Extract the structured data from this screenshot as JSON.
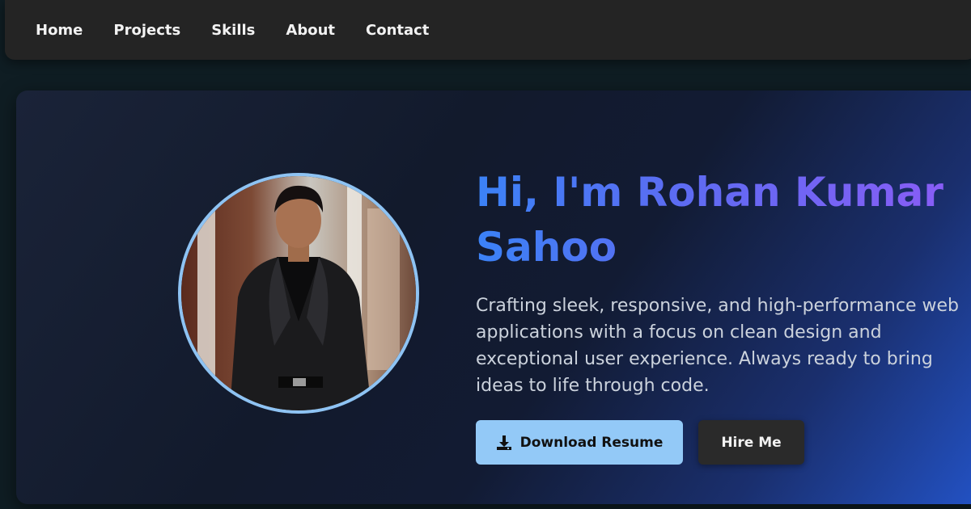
{
  "nav": {
    "items": [
      {
        "label": "Home"
      },
      {
        "label": "Projects"
      },
      {
        "label": "Skills"
      },
      {
        "label": "About"
      },
      {
        "label": "Contact"
      }
    ]
  },
  "hero": {
    "title": "Hi, I'm Rohan Kumar Sahoo",
    "description": "Crafting sleek, responsive, and high-performance web applications with a focus on clean design and exceptional user experience. Always ready to bring ideas to life through code.",
    "download_button": {
      "label": "Download Resume",
      "icon": "download-icon"
    },
    "hire_button": {
      "label": "Hire Me"
    }
  },
  "colors": {
    "accent": "#93c9f7",
    "title_gradient_start": "#3b82f6",
    "title_gradient_end": "#8b5cf6",
    "nav_bg": "#242424"
  }
}
